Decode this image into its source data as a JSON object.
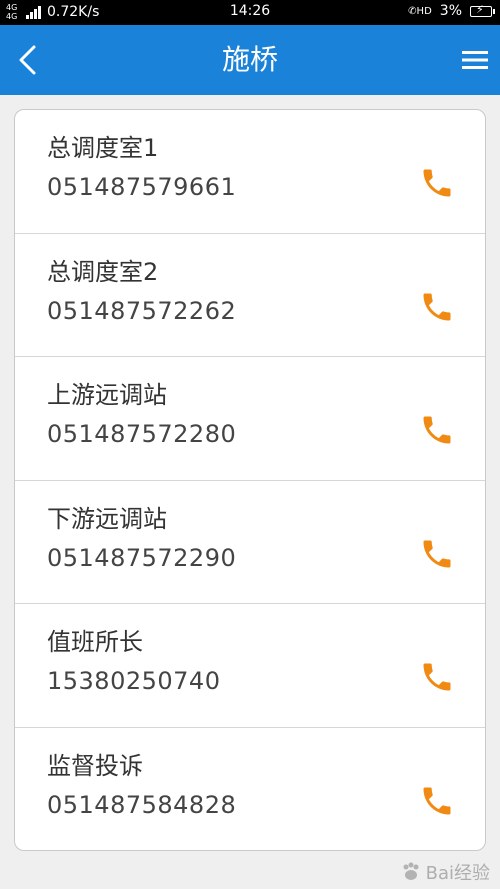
{
  "status_bar": {
    "network": "4G 4G",
    "speed": "0.72K/s",
    "time": "14:26",
    "hd": "HD",
    "battery_percent": "3%"
  },
  "app_bar": {
    "title": "施桥",
    "back_icon": "chevron-left-icon",
    "menu_icon": "hamburger-menu-icon"
  },
  "contacts": [
    {
      "name": "总调度室1",
      "phone": "051487579661"
    },
    {
      "name": "总调度室2",
      "phone": "051487572262"
    },
    {
      "name": "上游远调站",
      "phone": "051487572280"
    },
    {
      "name": "下游远调站",
      "phone": "051487572290"
    },
    {
      "name": "值班所长",
      "phone": "15380250740"
    },
    {
      "name": "监督投诉",
      "phone": "051487584828"
    }
  ],
  "watermark": {
    "text": "Bai经验"
  },
  "colors": {
    "app_bar": "#1a82d8",
    "call_icon": "#f08a12",
    "background": "#efefef"
  }
}
